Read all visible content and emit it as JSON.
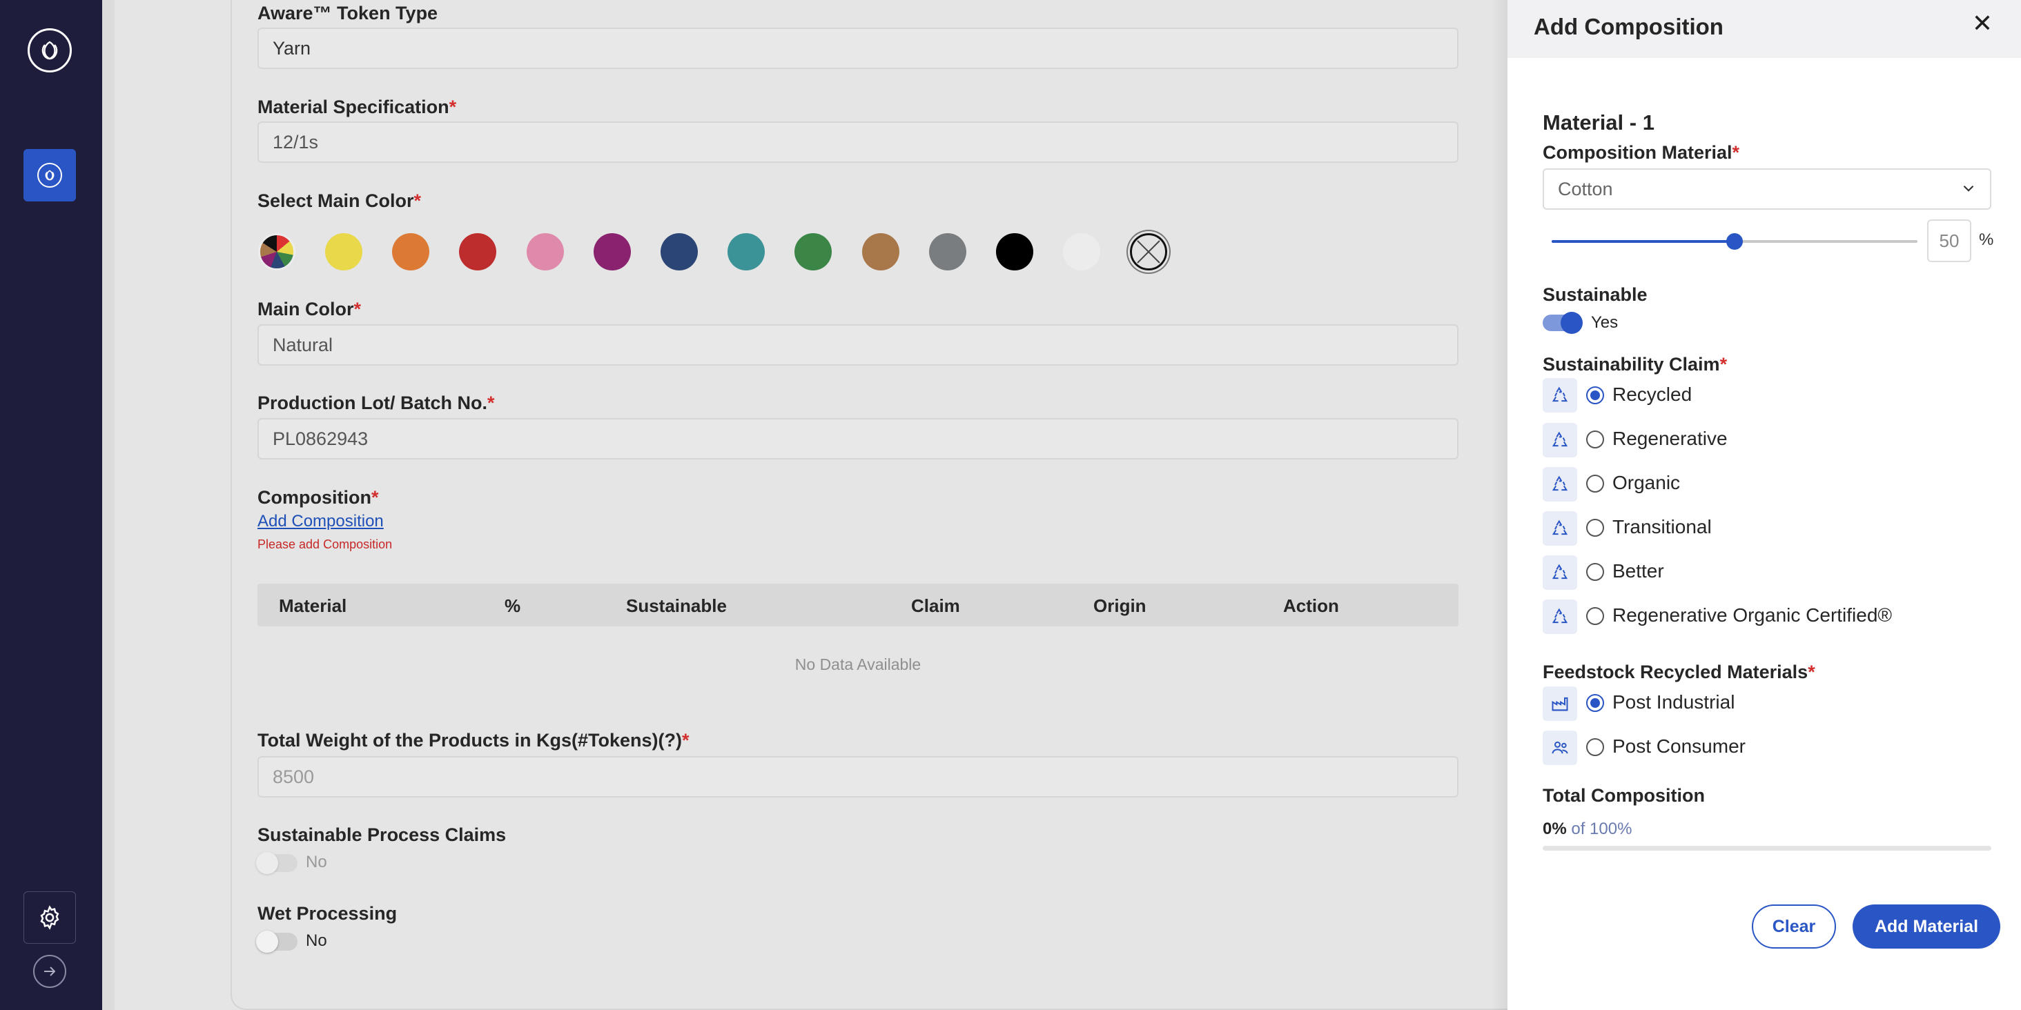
{
  "form": {
    "token_type": {
      "label": "Aware™ Token Type",
      "value": "Yarn"
    },
    "material_spec": {
      "label": "Material Specification",
      "required": "*",
      "value": "12/1s"
    },
    "main_color_picker": {
      "label": "Select Main Color",
      "required": "*",
      "colors": [
        "multicolor",
        "#e8d84a",
        "#dc7a35",
        "#bd2d2d",
        "#e08aab",
        "#8a2270",
        "#2b4676",
        "#3c9397",
        "#3b8547",
        "#a8774a",
        "#7a7d7f",
        "#000000",
        "#ececec",
        "natural-selected"
      ]
    },
    "main_color": {
      "label": "Main Color",
      "required": "*",
      "value": "Natural"
    },
    "batch_no": {
      "label": "Production Lot/ Batch No.",
      "required": "*",
      "value": "PL0862943"
    },
    "composition": {
      "label": "Composition",
      "required": "*",
      "add_link": "Add Composition",
      "error": "Please add Composition",
      "columns": [
        "Material",
        "%",
        "Sustainable",
        "Claim",
        "Origin",
        "Action"
      ],
      "empty_text": "No Data Available"
    },
    "total_weight": {
      "label": "Total Weight of the Products in Kgs(#Tokens)(?)",
      "required": "*",
      "placeholder": "8500"
    },
    "sustainable_process": {
      "label": "Sustainable Process Claims",
      "value": "No"
    },
    "wet_processing": {
      "label": "Wet Processing",
      "value": "No"
    }
  },
  "drawer": {
    "title": "Add Composition",
    "close_icon": "close-icon",
    "material_heading": "Material - 1",
    "composition_material": {
      "label": "Composition Material",
      "required": "*",
      "value": "Cotton"
    },
    "percent": {
      "value": "50",
      "sign": "%",
      "fraction": 0.5
    },
    "sustainable": {
      "label": "Sustainable",
      "value": "Yes"
    },
    "claim": {
      "label": "Sustainability Claim",
      "required": "*",
      "options": [
        "Recycled",
        "Regenerative",
        "Organic",
        "Transitional",
        "Better",
        "Regenerative Organic Certified®"
      ],
      "selected": "Recycled"
    },
    "feedstock": {
      "label": "Feedstock Recycled Materials",
      "required": "*",
      "options": [
        "Post Industrial",
        "Post Consumer"
      ],
      "selected": "Post Industrial"
    },
    "total_composition": {
      "label": "Total Composition",
      "value": "0%",
      "of": "of 100%",
      "fraction": 0
    },
    "buttons": {
      "clear": "Clear",
      "add": "Add Material"
    }
  },
  "colors": {
    "accent": "#2a55c5",
    "sidebar": "#1e1e3c",
    "required": "#d32f2f"
  }
}
